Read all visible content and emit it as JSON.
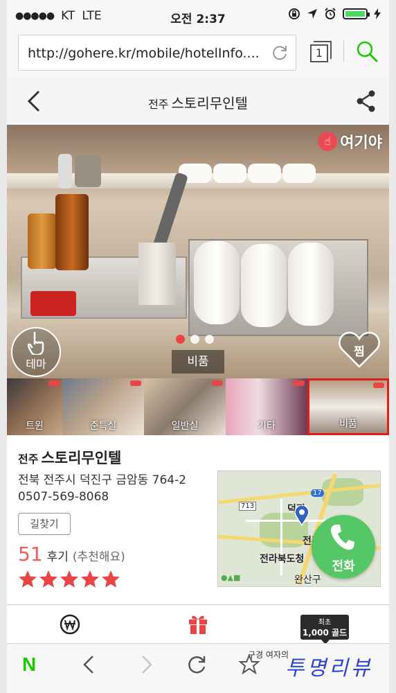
{
  "status": {
    "signal": "●●●●●",
    "carrier": "KT",
    "network": "LTE",
    "time": "오전 2:37"
  },
  "browser": {
    "url": "http://gohere.kr/mobile/hotelInfo....",
    "tab_count": "1"
  },
  "header": {
    "city": "전주",
    "title": "스토리무인텔"
  },
  "gallery": {
    "brand": "여기야",
    "theme_label": "테마",
    "caption": "비품",
    "zzim_label": "찜",
    "pager_count": 3,
    "pager_active": 0,
    "thumbnails": [
      {
        "label": "트윈"
      },
      {
        "label": "준특실"
      },
      {
        "label": "일반실"
      },
      {
        "label": "기타"
      },
      {
        "label": "비품",
        "selected": true
      }
    ]
  },
  "info": {
    "city": "전주",
    "name": "스토리무인텔",
    "address": "전북 전주시 덕진구 금암동 764-2",
    "phone": "0507-569-8068",
    "route_label": "길찾기",
    "review_count": "51",
    "review_label": "후기",
    "review_sub": "(추천해요)",
    "rating": 5
  },
  "map": {
    "labels": [
      "전라북도청",
      "전주",
      "완산구",
      "덕진"
    ],
    "road_numbers": [
      "713",
      "17"
    ]
  },
  "call": {
    "label": "전화"
  },
  "bottom_tabs": {
    "gold_line1": "최초",
    "gold_line2": "1,000 골드"
  },
  "watermark": {
    "small": "구경 여자의",
    "big": "투명리뷰"
  },
  "colors": {
    "accent_red": "#e94545",
    "call_green": "#55c766",
    "naver_green": "#1ec800",
    "battery_green": "#4cd964"
  }
}
